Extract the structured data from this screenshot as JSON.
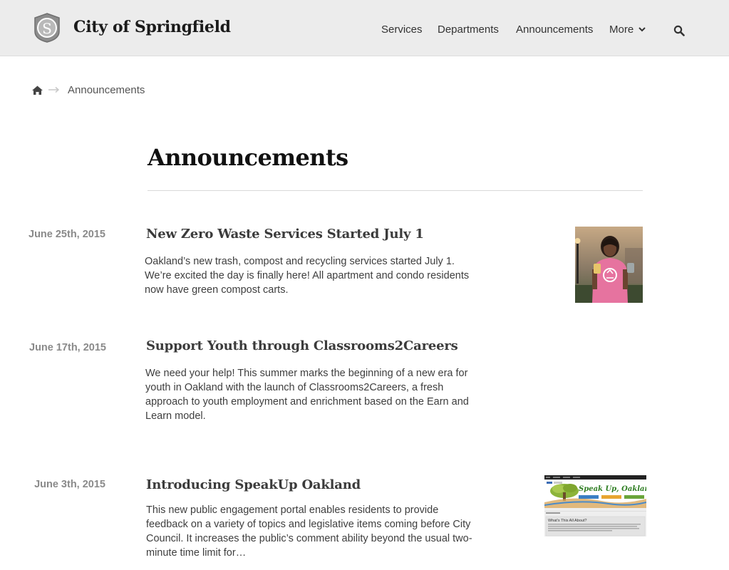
{
  "header": {
    "site_title": "City of Springfield",
    "logo_letter": "S",
    "nav": {
      "services": "Services",
      "departments": "Departments",
      "announcements": "Announcements",
      "more": "More"
    }
  },
  "breadcrumb": {
    "current": "Announcements"
  },
  "page": {
    "title": "Announcements"
  },
  "announcements": [
    {
      "date": "June 25th, 2015",
      "title": "New Zero Waste Services Started July 1",
      "summary": "Oakland’s new trash, compost and recycling services started July 1. We’re excited the day is finally here! All apartment and condo residents now have green compost carts."
    },
    {
      "date": "June 17th, 2015",
      "title": "Support Youth through Classrooms2Careers",
      "summary": "We need your help! This summer marks the beginning of a new era for youth in Oakland with the launch of Classrooms2Careers, a fresh approach to youth employment and enrichment based on the Earn and Learn model."
    },
    {
      "date": "June 3th, 2015",
      "title": "Introducing SpeakUp Oakland",
      "summary": "This new public engagement portal enables residents to provide feedback on a variety of topics and legislative items coming before City Council. It increases the public’s comment ability beyond the usual two-minute time limit for…"
    }
  ],
  "thumbnail_text": {
    "speakup_banner": "Speak Up, Oakland!",
    "speakup_heading": "What's This All About?"
  },
  "colors": {
    "header_bg": "#ececec",
    "date_text": "#8a8a8a",
    "headline_text": "#3b3b3b",
    "speakup_green": "#2e7d22"
  }
}
